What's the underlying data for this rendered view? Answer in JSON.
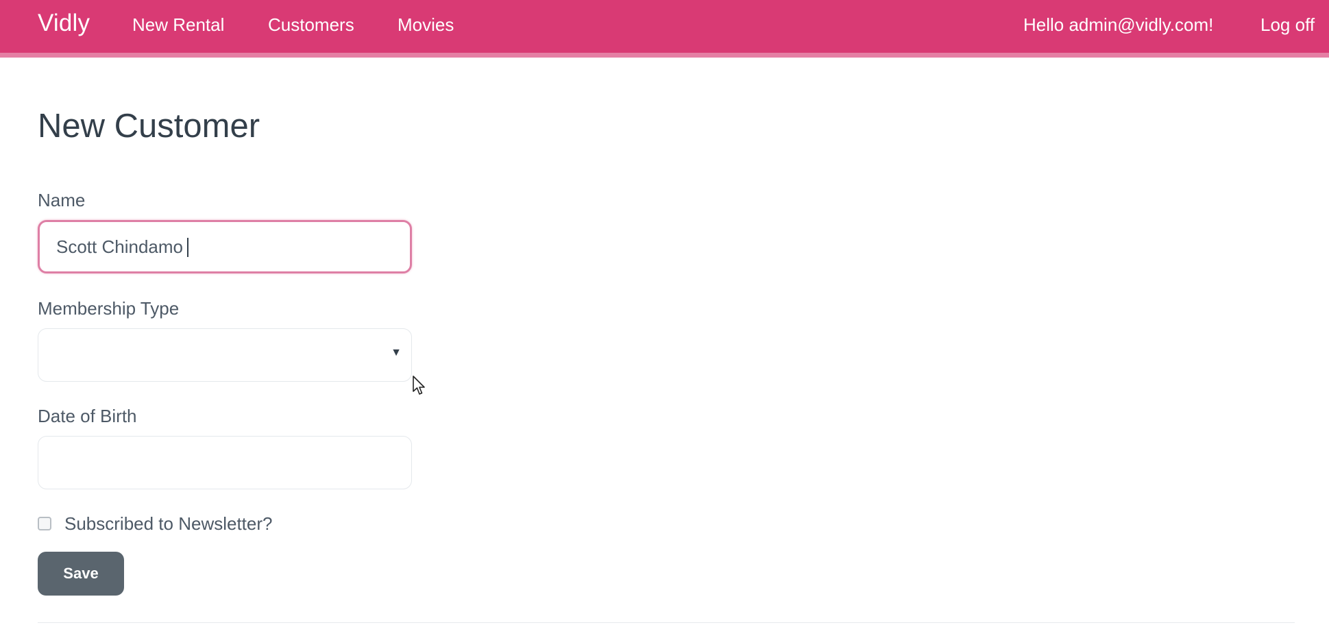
{
  "navbar": {
    "brand": "Vidly",
    "links": [
      {
        "label": "New Rental"
      },
      {
        "label": "Customers"
      },
      {
        "label": "Movies"
      }
    ],
    "greeting": "Hello admin@vidly.com!",
    "logoff": "Log off",
    "color": "#d93a74"
  },
  "form": {
    "title": "New Customer",
    "name_label": "Name",
    "name_value": "Scott Chindamo",
    "membership_label": "Membership Type",
    "membership_value": "",
    "dob_label": "Date of Birth",
    "dob_value": "",
    "newsletter_label": "Subscribed to Newsletter?",
    "newsletter_checked": false,
    "save_label": "Save"
  },
  "icons": {
    "select_arrow": "chevron-down-icon",
    "pointer": "mouse-cursor-icon"
  }
}
